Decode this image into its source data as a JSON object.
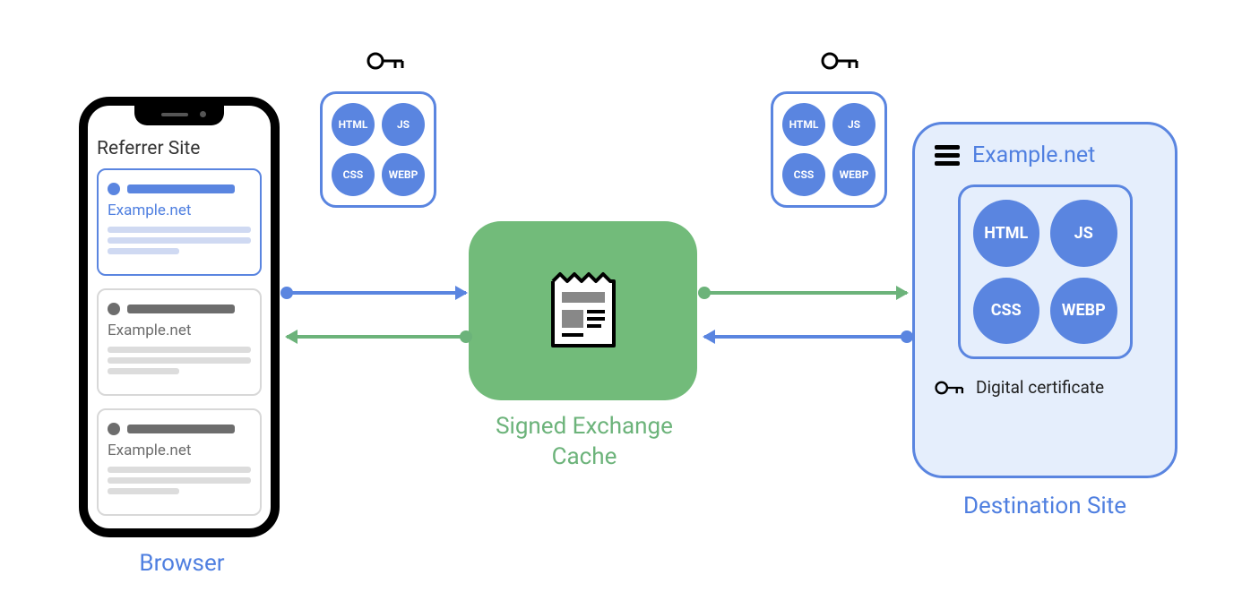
{
  "browser": {
    "label": "Browser",
    "referrer_title": "Referrer Site",
    "cards": [
      {
        "site": "Example.net"
      },
      {
        "site": "Example.net"
      },
      {
        "site": "Example.net"
      }
    ]
  },
  "bundle_assets": {
    "html": "HTML",
    "js": "JS",
    "css": "CSS",
    "webp": "WEBP"
  },
  "cache": {
    "label": "Signed Exchange\nCache"
  },
  "destination": {
    "label": "Destination Site",
    "title": "Example.net",
    "certificate": "Digital certificate"
  }
}
